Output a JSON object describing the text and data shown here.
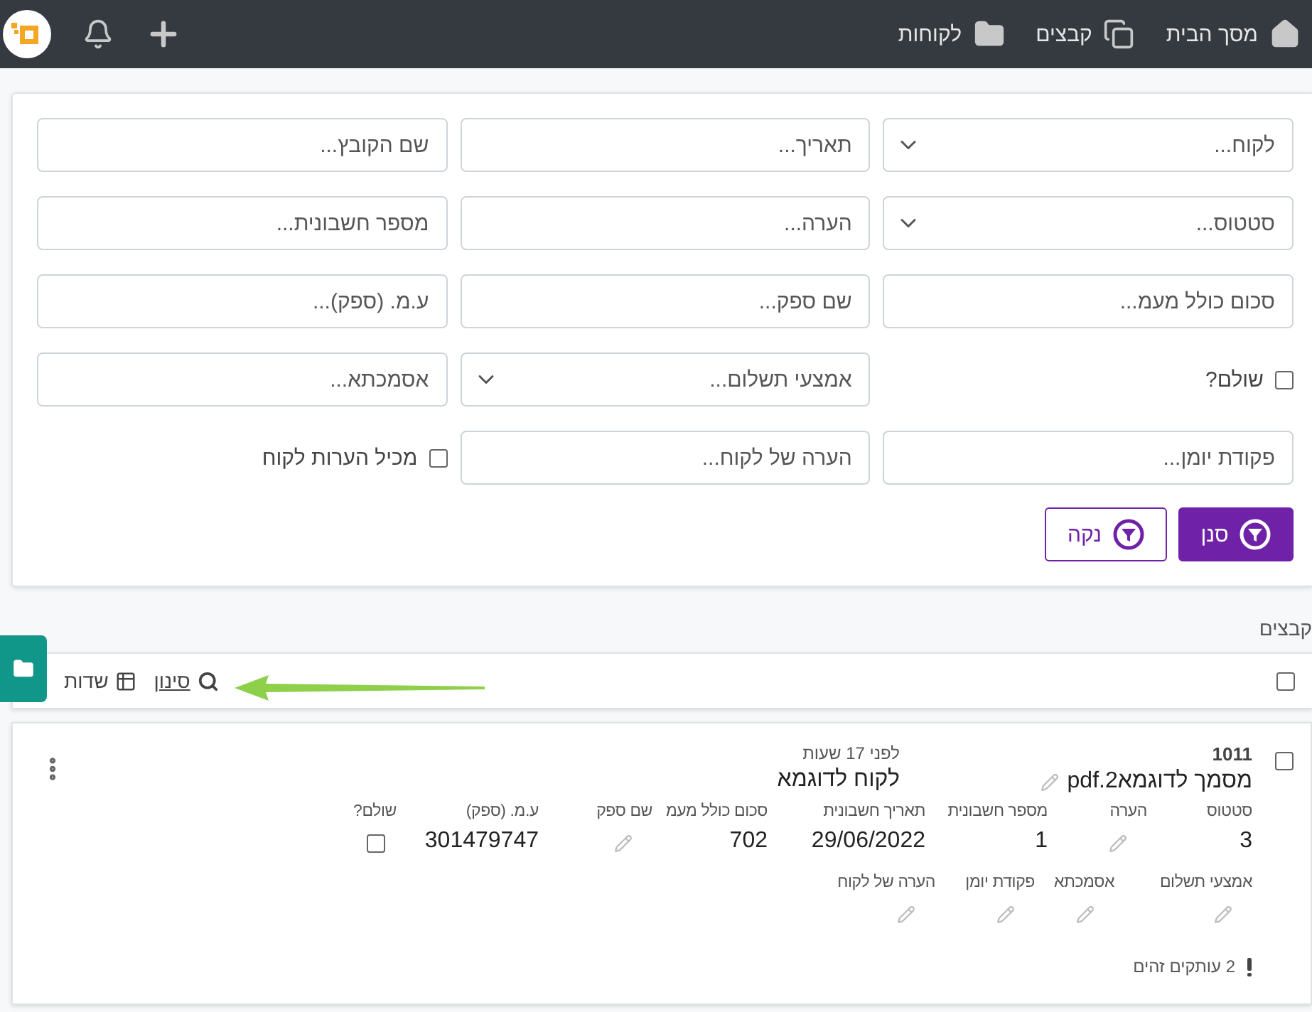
{
  "nav": {
    "items": [
      {
        "label": "מסך הבית"
      },
      {
        "label": "קבצים"
      },
      {
        "label": "לקוחות"
      }
    ]
  },
  "filters": {
    "fields": [
      {
        "kind": "select",
        "placeholder": "לקוח..."
      },
      {
        "kind": "text",
        "placeholder": "תאריך..."
      },
      {
        "kind": "text",
        "placeholder": "שם הקובץ..."
      },
      {
        "kind": "select",
        "placeholder": "סטטוס..."
      },
      {
        "kind": "text",
        "placeholder": "הערה..."
      },
      {
        "kind": "text",
        "placeholder": "מספר חשבונית..."
      },
      {
        "kind": "text",
        "placeholder": "סכום כולל מעמ..."
      },
      {
        "kind": "text",
        "placeholder": "שם ספק..."
      },
      {
        "kind": "text",
        "placeholder": "ע.מ. (ספק)..."
      },
      {
        "kind": "checkbox",
        "label": "שולם?",
        "checked": false
      },
      {
        "kind": "select",
        "placeholder": "אמצעי תשלום..."
      },
      {
        "kind": "text",
        "placeholder": "אסמכתא..."
      },
      {
        "kind": "text",
        "placeholder": "פקודת יומן..."
      },
      {
        "kind": "text",
        "placeholder": "הערה של לקוח..."
      },
      {
        "kind": "checkbox",
        "label": "מכיל הערות לקוח",
        "checked": false
      }
    ],
    "buttons": [
      {
        "label": "סנן",
        "kind": "primary"
      },
      {
        "label": "נקה",
        "kind": "outline"
      }
    ]
  },
  "files_count": "קבצים",
  "toolbar": {
    "select_all": false,
    "filter_link": "סינון",
    "fields_button": "שדות"
  },
  "record": {
    "selected": false,
    "id": "1011",
    "name": "מסמך לדוגמא2.pdf",
    "time": "לפני 17 שעות",
    "customer": "לקוח לדוגמא",
    "fields": [
      {
        "label": "סטטוס",
        "kind": "text",
        "value": "3"
      },
      {
        "label": "הערה",
        "kind": "edit"
      },
      {
        "label": "מספר חשבונית",
        "kind": "text",
        "value": "1"
      },
      {
        "label": "תאריך חשבונית",
        "kind": "text",
        "value": "29/06/2022"
      },
      {
        "label": "סכום כולל מעמ",
        "kind": "text",
        "value": "702"
      },
      {
        "label": "שם ספק",
        "kind": "edit"
      },
      {
        "label": "ע.מ. (ספק)",
        "kind": "text",
        "value": "301479747"
      },
      {
        "label": "שולם?",
        "kind": "checkbox",
        "checked": false
      }
    ],
    "fields_2": [
      {
        "label": "אמצעי תשלום",
        "kind": "edit"
      },
      {
        "label": "אסמכתא",
        "kind": "edit"
      },
      {
        "label": "פקודת יומן",
        "kind": "edit"
      },
      {
        "label": "הערה של לקוח",
        "kind": "edit"
      }
    ],
    "warning": "2 עותקים זהים"
  }
}
